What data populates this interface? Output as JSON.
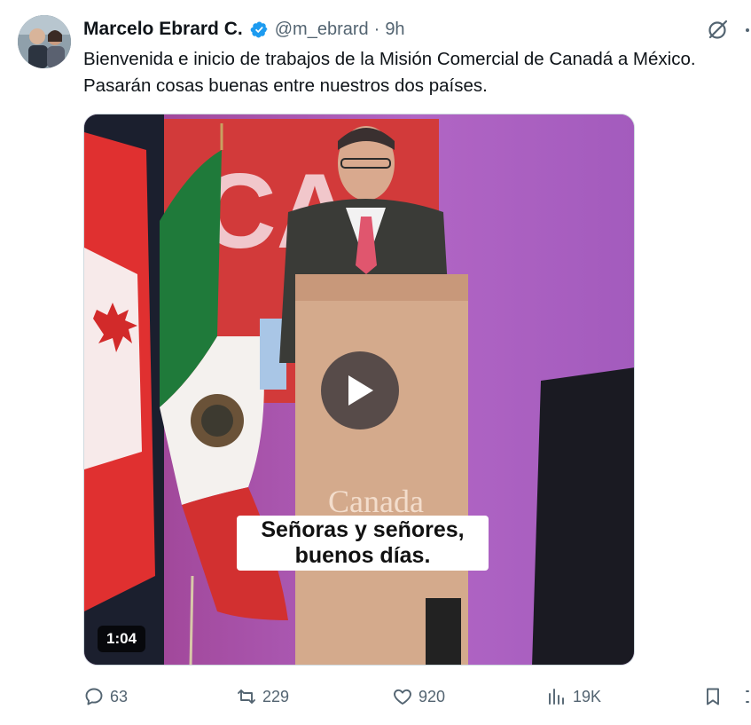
{
  "tweet": {
    "author_name": "Marcelo Ebrard C.",
    "handle": "@m_ebrard",
    "separator": "·",
    "time": "9h",
    "text": "Bienvenida e inicio de trabajos de la Misión Comercial de Canadá a México. Pasarán cosas buenas entre nuestros dos países."
  },
  "media": {
    "type": "video",
    "caption_line1": "Señoras y señores,",
    "caption_line2": "buenos días.",
    "duration": "1:04",
    "podium_text": "Canada"
  },
  "actions": {
    "replies": "63",
    "reposts": "229",
    "likes": "920",
    "views": "19K"
  },
  "icons": {
    "verified": "verified-badge-icon",
    "grok": "grok-icon",
    "reply": "reply-icon",
    "repost": "repost-icon",
    "like": "heart-icon",
    "views": "views-icon",
    "bookmark": "bookmark-icon",
    "share": "share-icon",
    "play": "play-icon"
  },
  "colors": {
    "verified": "#1d9bf0",
    "text": "#0f1419",
    "secondary": "#536471"
  }
}
